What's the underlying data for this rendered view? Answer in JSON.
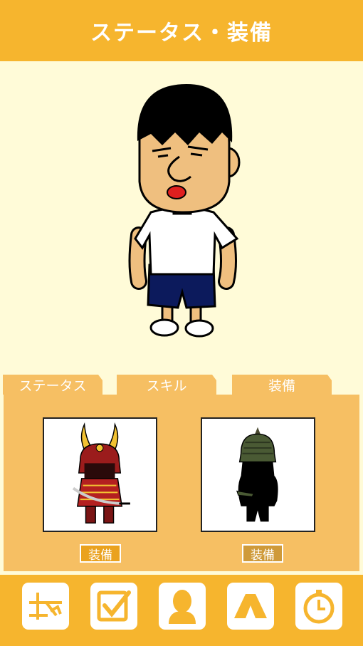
{
  "header": {
    "title": "ステータス・装備"
  },
  "tabs": [
    {
      "label": "ステータス",
      "active": false
    },
    {
      "label": "スキル",
      "active": false
    },
    {
      "label": "装備",
      "active": true
    }
  ],
  "equipment": {
    "items": [
      {
        "name_icon": "red-samurai-armor-icon",
        "button_label": "装備",
        "locked": false
      },
      {
        "name_icon": "dark-knight-silhouette-icon",
        "button_label": "装備",
        "locked": true
      }
    ]
  },
  "bottom_nav": [
    {
      "icon": "map-icon"
    },
    {
      "icon": "checklist-icon"
    },
    {
      "icon": "character-icon"
    },
    {
      "icon": "tent-icon"
    },
    {
      "icon": "stopwatch-icon"
    }
  ],
  "colors": {
    "accent": "#f6b52e",
    "panel": "#f6bf63",
    "background": "#fffbd8"
  }
}
